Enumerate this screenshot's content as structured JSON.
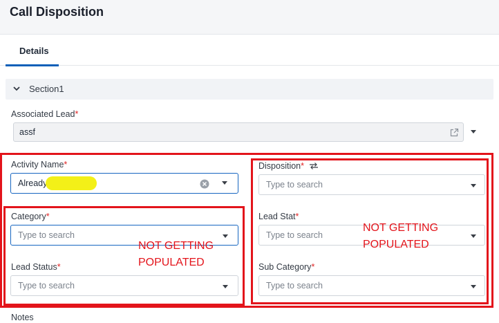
{
  "header": {
    "title": "Call Disposition"
  },
  "tabs": [
    {
      "label": "Details"
    }
  ],
  "section": {
    "title": "Section1"
  },
  "fields": {
    "associated_lead": {
      "label": "Associated Lead",
      "required": "*",
      "value": "assf"
    },
    "activity_name": {
      "label": "Activity Name",
      "required": "*",
      "value": "Already"
    },
    "disposition": {
      "label": "Disposition",
      "required": "*",
      "placeholder": "Type to search"
    },
    "category": {
      "label": "Category",
      "required": "*",
      "placeholder": "Type to search"
    },
    "lead_stat": {
      "label": "Lead Stat",
      "required": "*",
      "placeholder": "Type to search"
    },
    "lead_status": {
      "label": "Lead Status",
      "required": "*",
      "placeholder": "Type to search"
    },
    "sub_category": {
      "label": "Sub Category",
      "required": "*",
      "placeholder": "Type to search"
    },
    "notes": {
      "label": "Notes"
    }
  },
  "annotations": {
    "left": {
      "line1": "NOT GETTING",
      "line2": "POPULATED"
    },
    "right": {
      "line1": "NOT GETTING",
      "line2": "POPULATED"
    }
  },
  "colors": {
    "accent": "#0b5fb8",
    "annotation": "#e3141b",
    "required": "#e02424",
    "highlight": "#f3f018"
  }
}
